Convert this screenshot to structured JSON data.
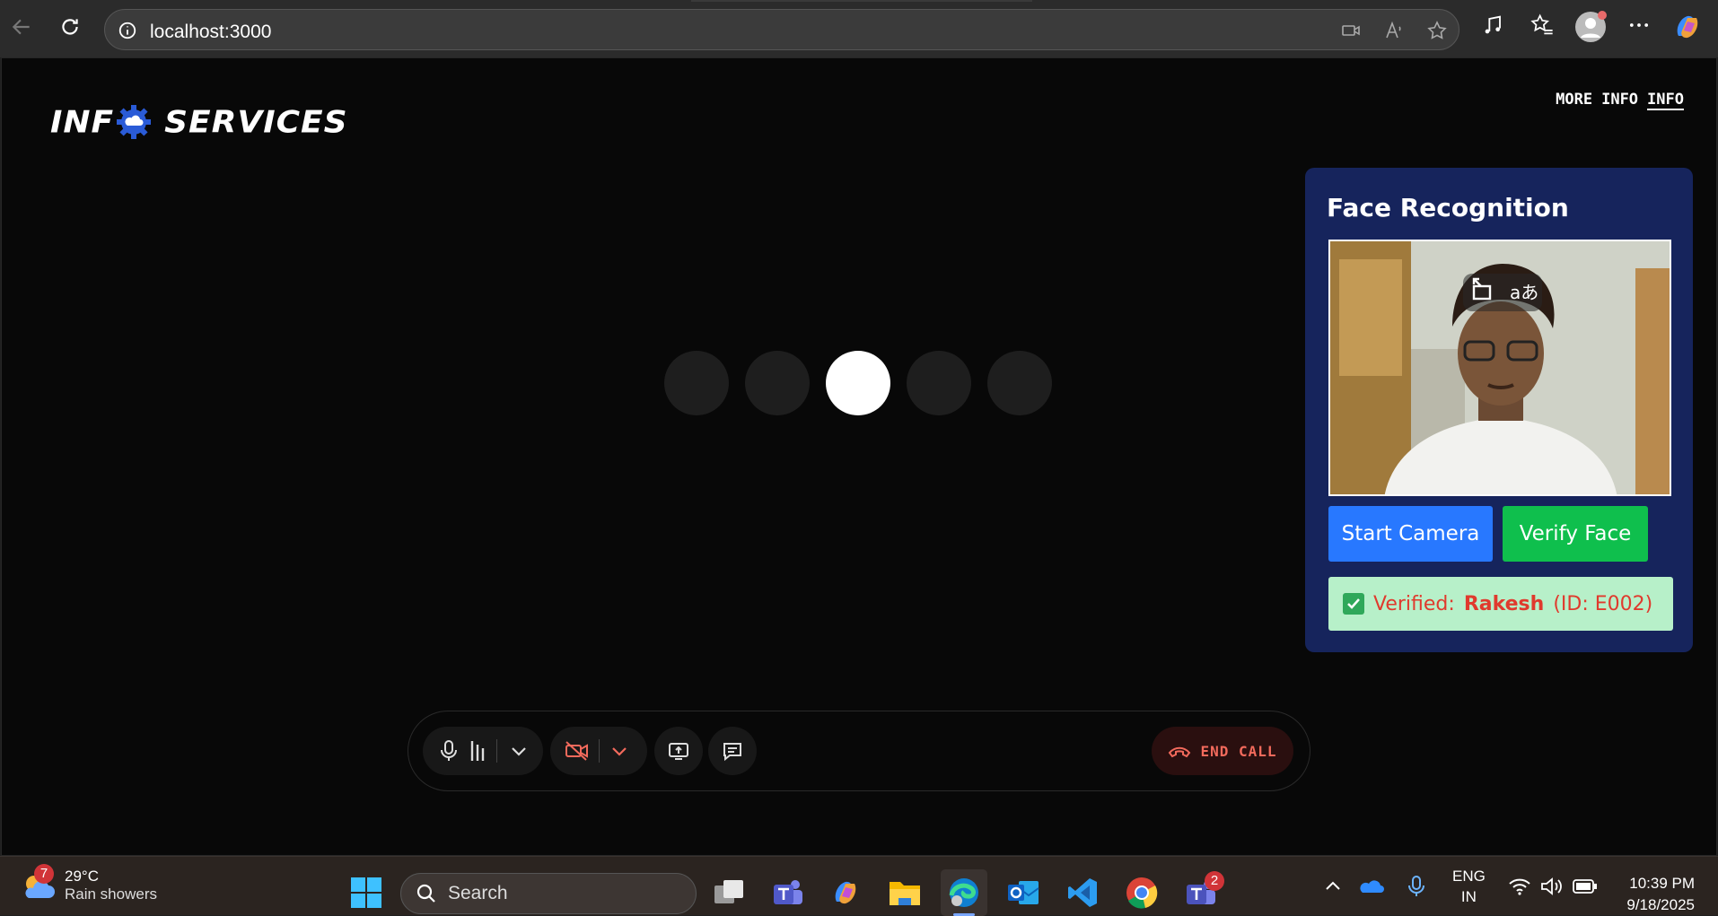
{
  "browser": {
    "url": "localhost:3000"
  },
  "app": {
    "logo_text_left": "INF",
    "logo_text_right": "SERVICES",
    "links": [
      "MORE",
      "INFO",
      "INFO"
    ],
    "loader_dots": 5,
    "loader_active_index": 2
  },
  "face_panel": {
    "title": "Face Recognition",
    "start_camera_label": "Start Camera",
    "verify_face_label": "Verify Face",
    "status_prefix": "Verified:",
    "status_name": "Rakesh",
    "status_id": "(ID: E002)",
    "colors": {
      "panel": "#16245c",
      "start": "#2878ff",
      "verify": "#0fbf4d",
      "status_bg": "#b7f0c9",
      "status_text": "#e03a2d"
    }
  },
  "call_controls": {
    "end_call_label": "END CALL"
  },
  "taskbar": {
    "weather_badge": "7",
    "temperature": "29°C",
    "weather": "Rain showers",
    "search_placeholder": "Search",
    "teams_badge": "2",
    "lang_top": "ENG",
    "lang_bottom": "IN",
    "time": "10:39 PM",
    "date": "9/18/2025"
  }
}
